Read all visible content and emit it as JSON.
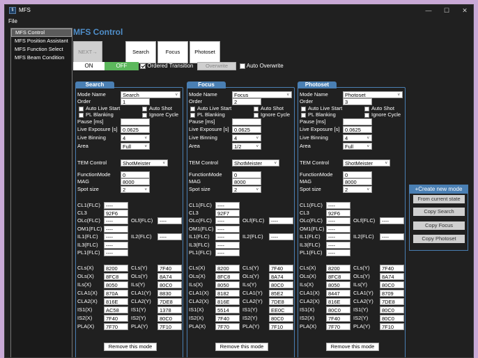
{
  "window": {
    "title": "MFS",
    "icon_text": "ﬁ",
    "minimize": "—",
    "maximize": "☐",
    "close": "✕"
  },
  "menu": {
    "file": "File"
  },
  "sidebar": {
    "items": [
      {
        "label": "MFS Control"
      },
      {
        "label": "MFS Position Assistant"
      },
      {
        "label": "MFS Function Select"
      },
      {
        "label": "MFS Beam Condition"
      }
    ]
  },
  "heading": "MFS Control",
  "toolbar": {
    "next": "NEXT→",
    "search": "Search",
    "focus": "Focus",
    "photoset": "Photoset",
    "on": "ON",
    "off": "OFF",
    "ordered": "Ordered Transition",
    "overwrite": "Overwrite",
    "auto_overwrite": "Auto Overwrite"
  },
  "labels": {
    "mode_name": "Mode Name",
    "order": "Order",
    "auto_live_start": "Auto Live Start",
    "auto_shot": "Auto Shot",
    "pl_blanking": "PL Blanking",
    "ignore_cycle": "Ignore Cycle",
    "pause": "Pause [ms]",
    "live_exposure": "Live Exposure [s]",
    "live_binning": "Live Binning",
    "area": "Area",
    "tem_control": "TEM Control",
    "function_mode": "FunctionMode",
    "mag": "MAG",
    "spot_size": "Spot size",
    "cl1": "CL1(FLC)",
    "cl3": "CL3",
    "olc": "OLc(FLC)",
    "olf": "OLf(FLC)",
    "om1": "OM1(FLC)",
    "il1": "IL1(FLC)",
    "il2": "IL2(FLC)",
    "il3": "IL3(FLC)",
    "pl1": "PL1(FLC)",
    "cls_x": "CLs(X)",
    "cls_y": "CLs(Y)",
    "ols_x": "OLs(X)",
    "ols_y": "OLs(Y)",
    "ils_x": "ILs(X)",
    "ils_y": "ILs(Y)",
    "cla1_x": "CLA1(X)",
    "cla1_y": "CLA1(Y)",
    "cla2_x": "CLA2(X)",
    "cla2_y": "CLA2(Y)",
    "is1_x": "IS1(X)",
    "is1_y": "IS1(Y)",
    "is2_x": "IS2(X)",
    "is2_y": "IS2(Y)",
    "pla_x": "PLA(X)",
    "pla_y": "PLA(Y)",
    "remove": "Remove this mode"
  },
  "panels": [
    {
      "tab": "Search",
      "mode_name": "Search",
      "order": "1",
      "pause": "",
      "live_exposure": "0.0625",
      "live_binning": "4",
      "area": "Full",
      "tem_control": "ShotMeister",
      "function_mode": "0",
      "mag": "8000",
      "spot_size": "2",
      "cl1": "----",
      "cl3": "92F6",
      "olc": "----",
      "olf": "----",
      "om1": "----",
      "il1": "----",
      "il2": "----",
      "il3": "----",
      "pl1": "----",
      "cls_x": "8200",
      "cls_y": "7F40",
      "ols_x": "8FC8",
      "ols_y": "8A74",
      "ils_x": "8050",
      "ils_y": "80C0",
      "cla1_x": "870A",
      "cla1_y": "8830",
      "cla2_x": "816E",
      "cla2_y": "7DE8",
      "is1_x": "AC58",
      "is1_y": "1378",
      "is2_x": "7F40",
      "is2_y": "80C0",
      "pla_x": "7F70",
      "pla_y": "7F10"
    },
    {
      "tab": "Focus",
      "mode_name": "Focus",
      "order": "2",
      "pause": "",
      "live_exposure": "0.0625",
      "live_binning": "4",
      "area": "1/2",
      "tem_control": "ShotMeister",
      "function_mode": "0",
      "mag": "8000",
      "spot_size": "2",
      "cl1": "----",
      "cl3": "92F7",
      "olc": "----",
      "olf": "----",
      "om1": "----",
      "il1": "----",
      "il2": "----",
      "il3": "----",
      "pl1": "----",
      "cls_x": "8200",
      "cls_y": "7F40",
      "ols_x": "8FC8",
      "ols_y": "8A74",
      "ils_x": "8050",
      "ils_y": "80C0",
      "cla1_x": "8182",
      "cla1_y": "85E2",
      "cla2_x": "816E",
      "cla2_y": "7DE8",
      "is1_x": "5514",
      "is1_y": "EE0C",
      "is2_x": "7F40",
      "is2_y": "80C0",
      "pla_x": "7F70",
      "pla_y": "7F10"
    },
    {
      "tab": "Photoset",
      "mode_name": "Photoset",
      "order": "3",
      "pause": "",
      "live_exposure": "0.0625",
      "live_binning": "4",
      "area": "Full",
      "tem_control": "ShotMeister",
      "function_mode": "0",
      "mag": "8000",
      "spot_size": "2",
      "cl1": "----",
      "cl3": "92F6",
      "olc": "----",
      "olf": "----",
      "om1": "----",
      "il1": "----",
      "il2": "----",
      "il3": "----",
      "pl1": "----",
      "cls_x": "8200",
      "cls_y": "7F40",
      "ols_x": "8FC8",
      "ols_y": "8A74",
      "ils_x": "8050",
      "ils_y": "80C0",
      "cla1_x": "8447",
      "cla1_y": "8709",
      "cla2_x": "816E",
      "cla2_y": "7DE8",
      "is1_x": "80C0",
      "is1_y": "80C0",
      "is2_x": "7F40",
      "is2_y": "80C0",
      "pla_x": "7F70",
      "pla_y": "7F10"
    }
  ],
  "create": {
    "title": "+Create new mode",
    "from_current": "From current state",
    "copy_search": "Copy Search",
    "copy_focus": "Copy Focus",
    "copy_photoset": "Copy Photoset"
  }
}
